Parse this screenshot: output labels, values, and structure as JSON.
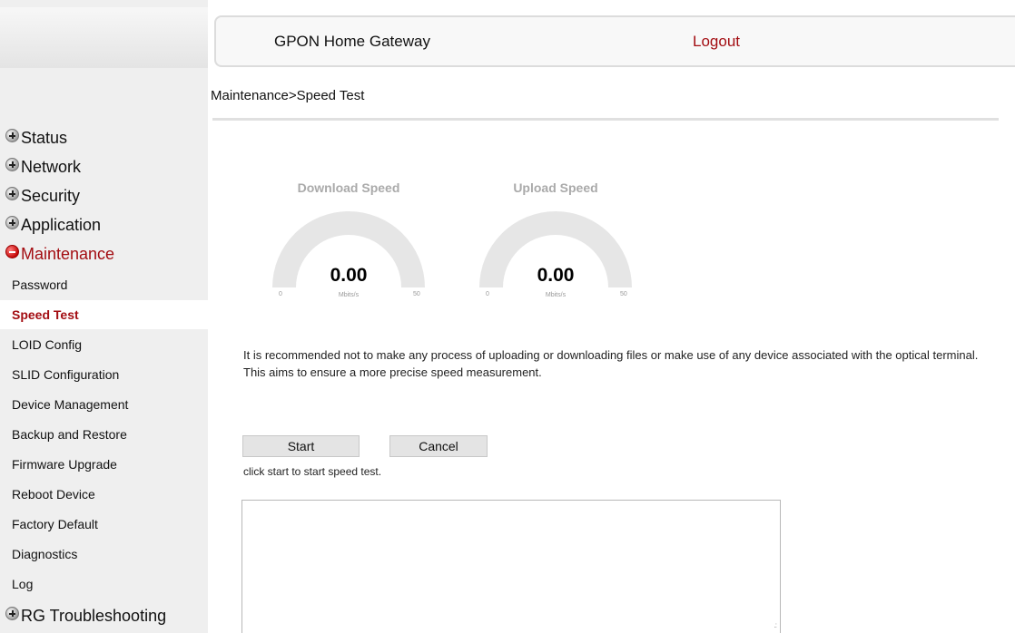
{
  "header": {
    "title": "GPON Home Gateway",
    "logout": "Logout"
  },
  "breadcrumb": "Maintenance>Speed Test",
  "sidebar": {
    "menus": [
      {
        "label": "Status",
        "state": "collapsed"
      },
      {
        "label": "Network",
        "state": "collapsed"
      },
      {
        "label": "Security",
        "state": "collapsed"
      },
      {
        "label": "Application",
        "state": "collapsed"
      },
      {
        "label": "Maintenance",
        "state": "expanded"
      }
    ],
    "submenu": [
      {
        "label": "Password"
      },
      {
        "label": "Speed Test",
        "active": true
      },
      {
        "label": "LOID Config"
      },
      {
        "label": "SLID Configuration"
      },
      {
        "label": "Device Management"
      },
      {
        "label": "Backup and Restore"
      },
      {
        "label": "Firmware Upgrade"
      },
      {
        "label": "Reboot Device"
      },
      {
        "label": "Factory Default"
      },
      {
        "label": "Diagnostics"
      },
      {
        "label": "Log"
      }
    ],
    "last_menu": {
      "label": "RG Troubleshooting",
      "state": "collapsed"
    }
  },
  "gauges": {
    "download": {
      "title": "Download Speed",
      "value": "0.00",
      "unit": "Mbits/s",
      "min": "0",
      "max": "50",
      "level": 0
    },
    "upload": {
      "title": "Upload Speed",
      "value": "0.00",
      "unit": "Mbits/s",
      "min": "0",
      "max": "50",
      "level": 0
    }
  },
  "notice": {
    "line1": "It is recommended not to make any process of uploading or downloading files or make use of any device associated with the optical terminal.",
    "line2": "This aims to ensure a more precise speed measurement."
  },
  "buttons": {
    "start": "Start",
    "cancel": "Cancel"
  },
  "hint": "click start to start speed test.",
  "result": "",
  "colors": {
    "accent": "#a30d12",
    "sidebar_bg": "#efefef",
    "gauge_track": "#e6e6e6"
  }
}
